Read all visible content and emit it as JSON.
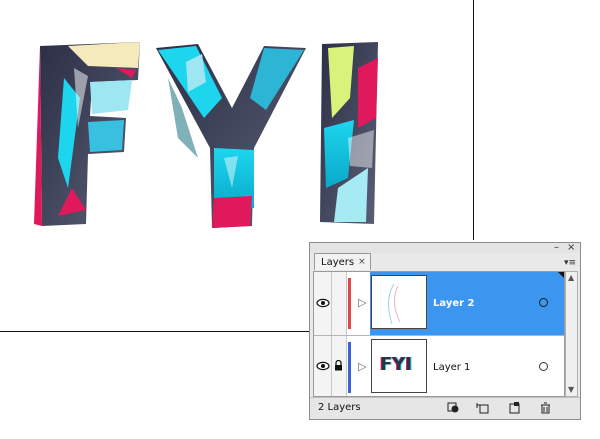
{
  "artwork": {
    "text": "FYI"
  },
  "panel": {
    "tab_label": "Layers",
    "tab_close": "×",
    "window_minimize": "–",
    "window_close": "×",
    "menu_glyph": "▾≡",
    "layers": [
      {
        "name": "Layer 2",
        "selected": true,
        "color": "#e04848",
        "locked": false,
        "visible": true
      },
      {
        "name": "Layer 1",
        "selected": false,
        "color": "#3a62d8",
        "locked": true,
        "visible": true
      }
    ],
    "thumb2_text": "FYI",
    "layer_count": "2 Layers",
    "expand_glyph": "▷",
    "scroll_up": "▲",
    "scroll_down": "▼",
    "colors": {
      "selection": "#3b96f0",
      "panel_bg": "#e9e9e9"
    }
  }
}
